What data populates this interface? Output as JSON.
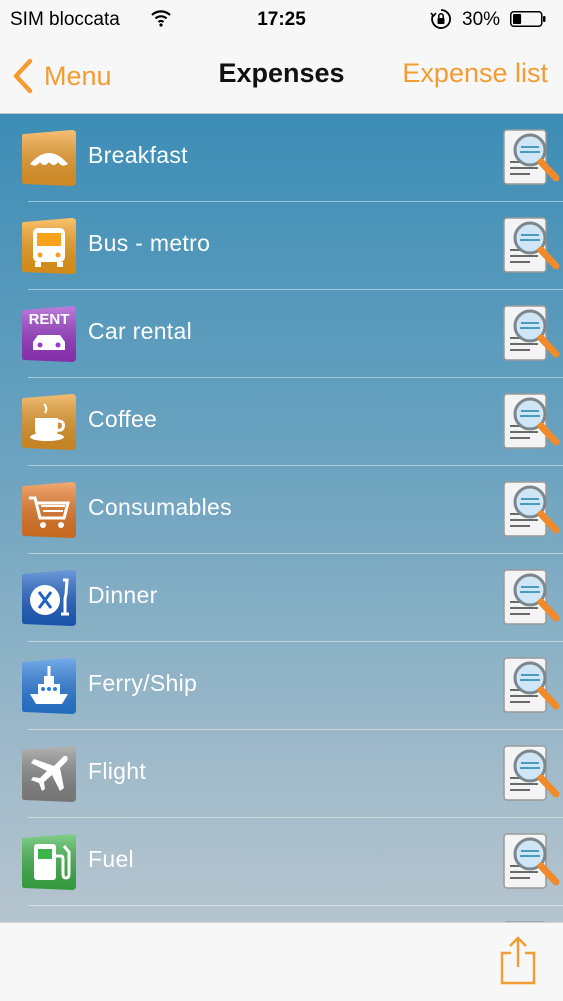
{
  "status_bar": {
    "carrier": "SIM bloccata",
    "time": "17:25",
    "battery_percent": "30%",
    "battery_level": 0.3,
    "icons": [
      "wifi-icon",
      "orientation-lock-icon",
      "battery-icon"
    ]
  },
  "nav": {
    "back_label": "Menu",
    "title": "Expenses",
    "right_label": "Expense list",
    "accent_color": "#f39c33"
  },
  "expenses": [
    {
      "label": "Breakfast",
      "icon": "croissant-icon",
      "color": "#f2a02a"
    },
    {
      "label": "Bus - metro",
      "icon": "bus-icon",
      "color": "#f7a21b"
    },
    {
      "label": "Car rental",
      "icon": "rent-car-icon",
      "color": "#9b38c9",
      "icon_text": "RENT"
    },
    {
      "label": "Coffee",
      "icon": "coffee-cup-icon",
      "color": "#e89a28"
    },
    {
      "label": "Consumables",
      "icon": "shopping-cart-icon",
      "color": "#ea7a25"
    },
    {
      "label": "Dinner",
      "icon": "dinner-icon",
      "color": "#1e62c8"
    },
    {
      "label": "Ferry/Ship",
      "icon": "ship-icon",
      "color": "#2a7ee0"
    },
    {
      "label": "Flight",
      "icon": "airplane-icon",
      "color": "#8a8a8a"
    },
    {
      "label": "Fuel",
      "icon": "fuel-pump-icon",
      "color": "#3db54a"
    },
    {
      "label": "",
      "icon": "partial-icon",
      "color": "#3aa6e6"
    }
  ],
  "toolbar": {
    "share_icon": "share-icon"
  }
}
